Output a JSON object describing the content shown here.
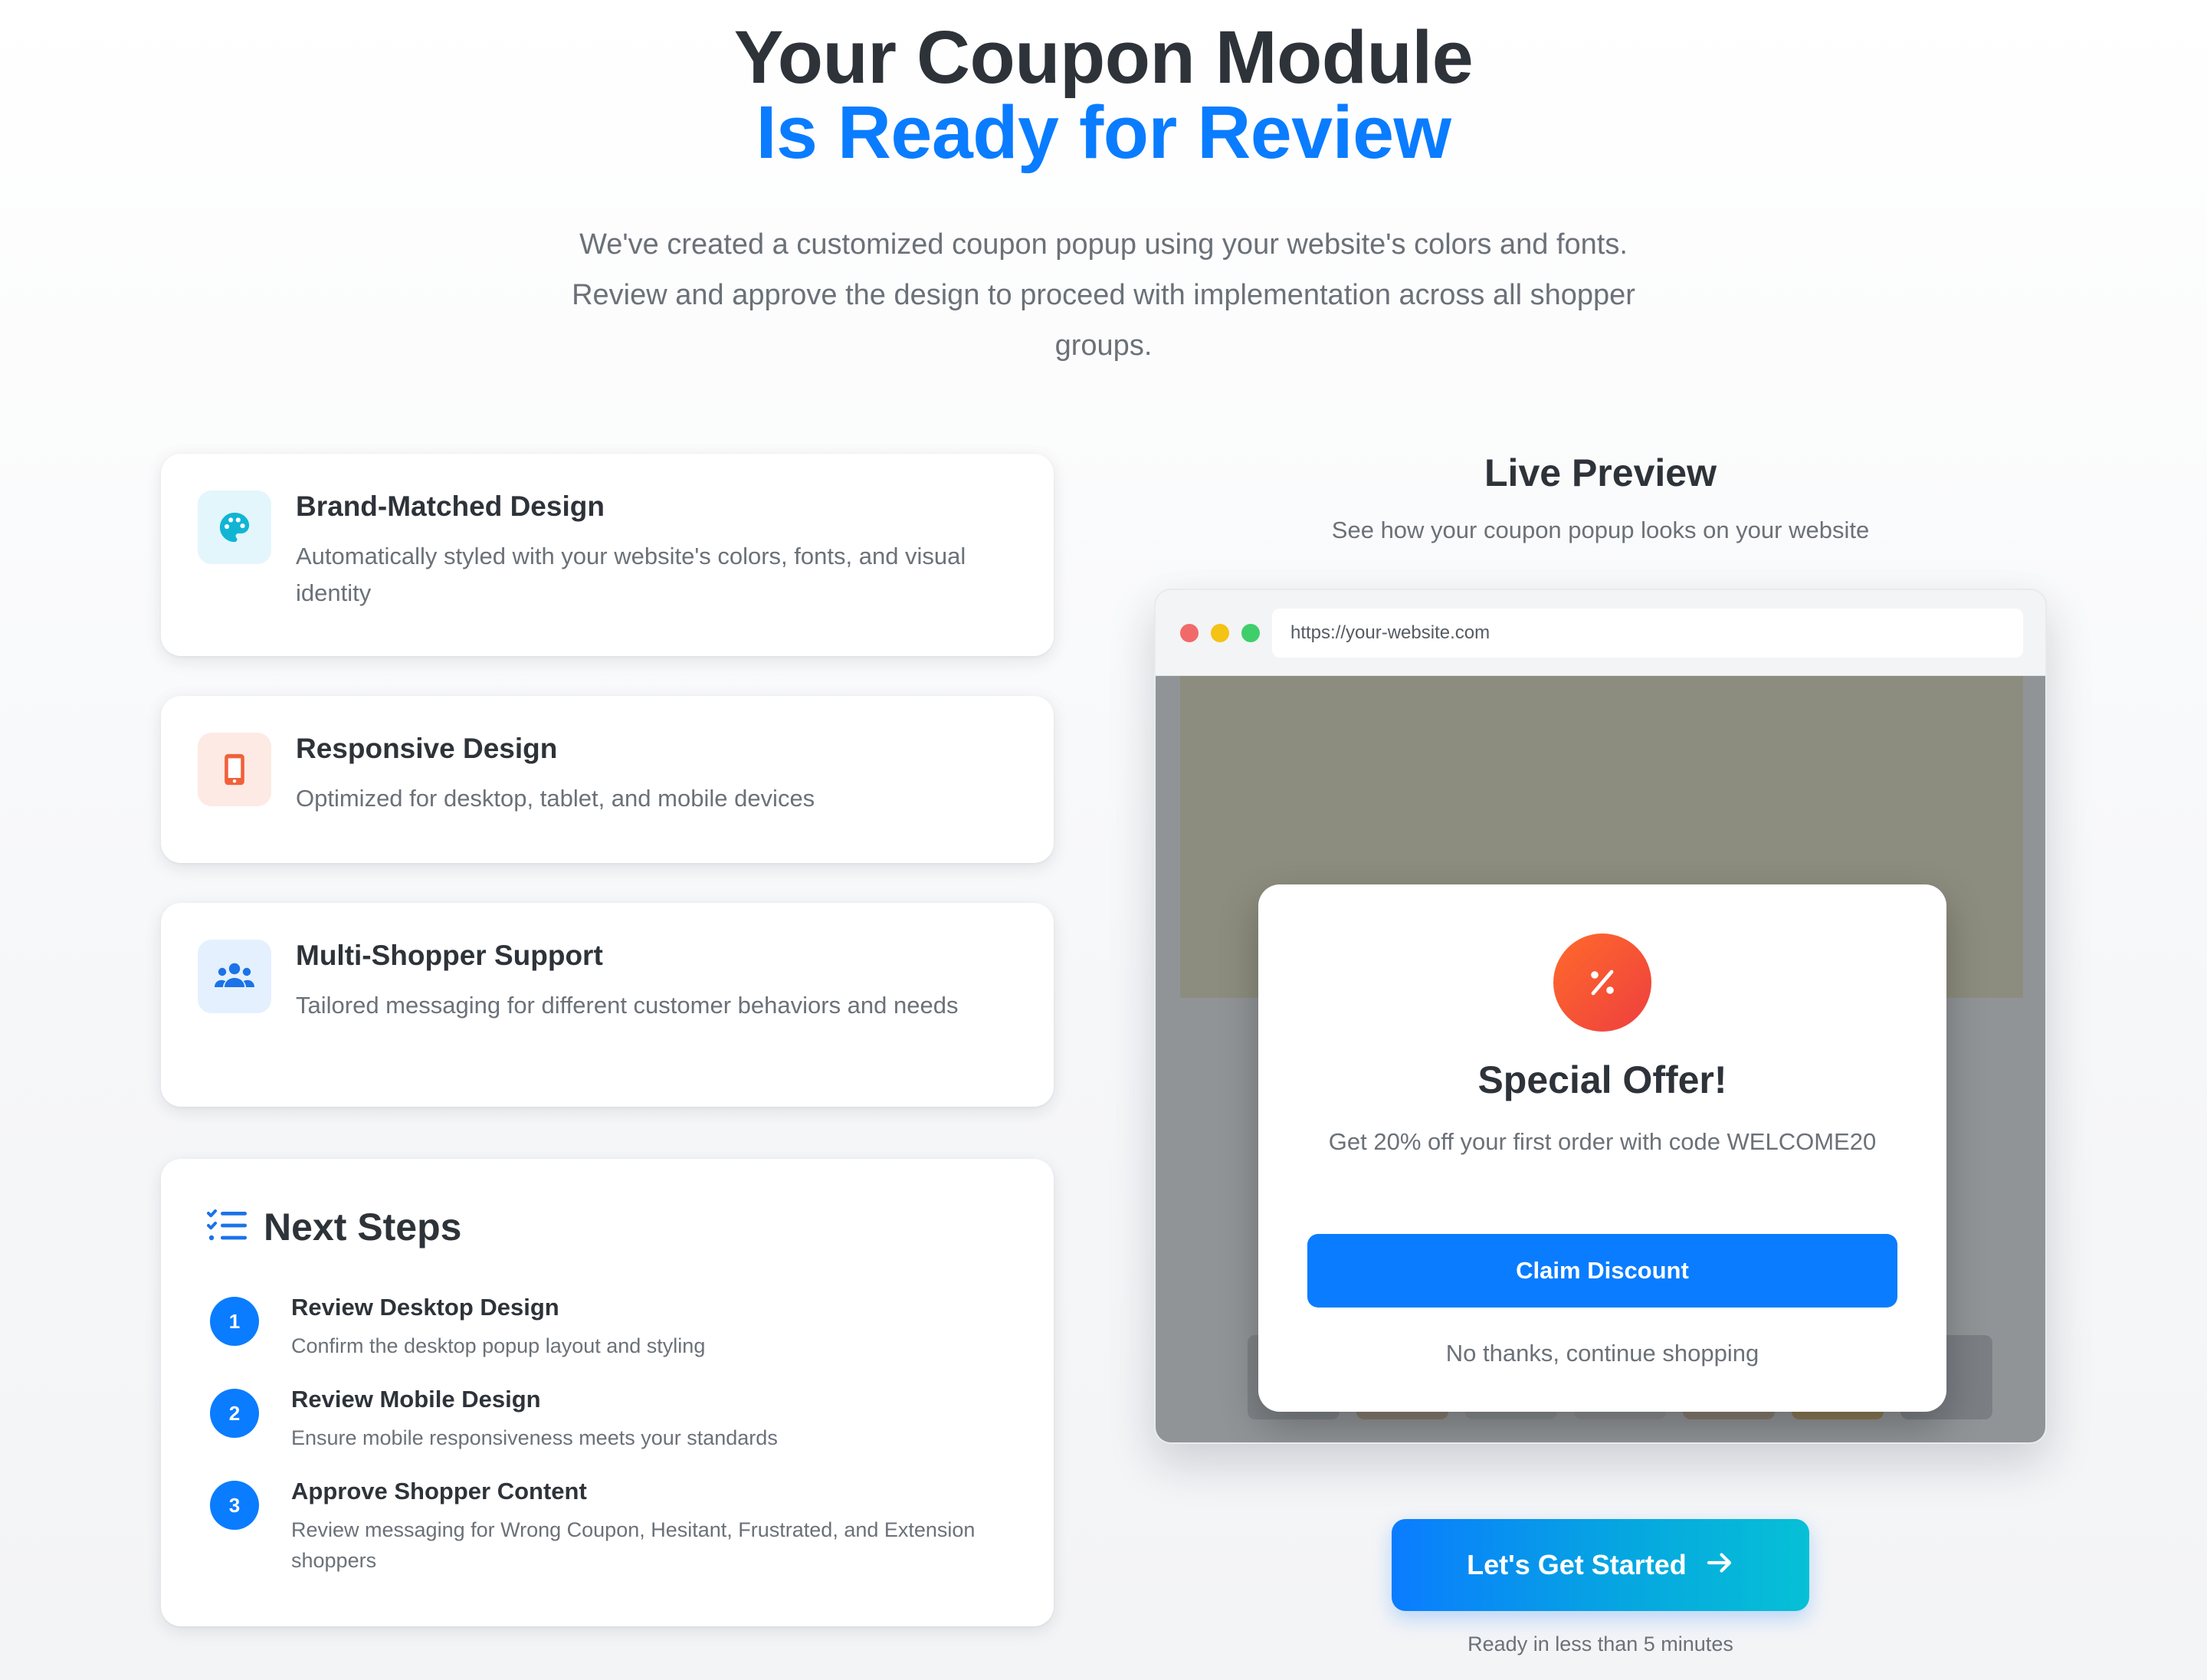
{
  "hero": {
    "title_line1": "Your Coupon Module",
    "title_line2": "Is Ready for Review",
    "subtitle": "We've created a customized coupon popup using your website's colors and fonts. Review and approve the design to proceed with implementation across all shopper groups."
  },
  "features": [
    {
      "icon": "palette-icon",
      "title": "Brand-Matched Design",
      "description": "Automatically styled with your website's colors, fonts, and visual identity"
    },
    {
      "icon": "mobile-icon",
      "title": "Responsive Design",
      "description": "Optimized for desktop, tablet, and mobile devices"
    },
    {
      "icon": "users-icon",
      "title": "Multi-Shopper Support",
      "description": "Tailored messaging for different customer behaviors and needs"
    }
  ],
  "next_steps": {
    "title": "Next Steps",
    "icon": "checklist-icon",
    "items": [
      {
        "number": "1",
        "title": "Review Desktop Design",
        "description": "Confirm the desktop popup layout and styling"
      },
      {
        "number": "2",
        "title": "Review Mobile Design",
        "description": "Ensure mobile responsiveness meets your standards"
      },
      {
        "number": "3",
        "title": "Approve Shopper Content",
        "description": "Review messaging for Wrong Coupon, Hesitant, Frustrated, and Extension shoppers"
      }
    ]
  },
  "preview": {
    "title": "Live Preview",
    "subtitle": "See how your coupon popup looks on your website",
    "url": "https://your-website.com",
    "popup": {
      "icon": "percent-icon",
      "title": "Special Offer!",
      "offer": "Get 20% off your first order with code WELCOME20",
      "claim_label": "Claim Discount",
      "dismiss_label": "No thanks, continue shopping"
    }
  },
  "cta": {
    "label": "Let's Get Started",
    "note": "Ready in less than 5 minutes"
  },
  "colors": {
    "accent": "#0a7cff",
    "heading": "#2d3339",
    "muted": "#6b7178",
    "popup_badge": "#ee3f3f",
    "dot_red": "#f16a6a",
    "dot_yellow": "#f5c216",
    "dot_green": "#3fcf6a"
  }
}
